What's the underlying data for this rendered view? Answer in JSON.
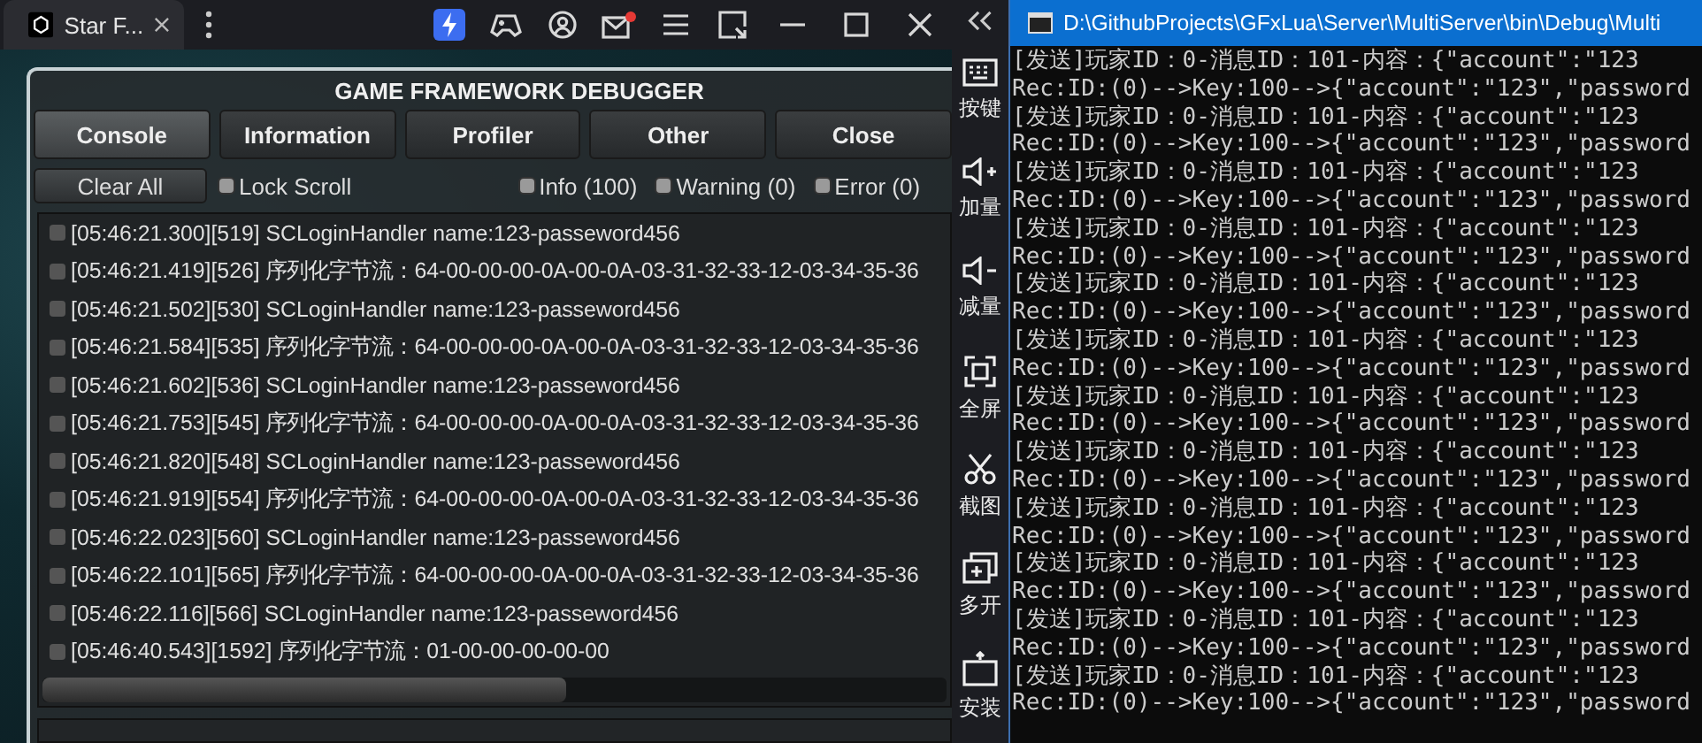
{
  "emulator": {
    "tab": {
      "title": "Star F..."
    },
    "debugger": {
      "title": "GAME FRAMEWORK DEBUGGER",
      "tabs": [
        {
          "label": "Console",
          "selected": true
        },
        {
          "label": "Information",
          "selected": false
        },
        {
          "label": "Profiler",
          "selected": false
        },
        {
          "label": "Other",
          "selected": false
        },
        {
          "label": "Close",
          "selected": false
        }
      ],
      "clear_button": "Clear All",
      "toggles": [
        {
          "label": "Lock Scroll",
          "checked": false
        },
        {
          "label": "Info (100)",
          "checked": false
        },
        {
          "label": "Warning (0)",
          "checked": false
        },
        {
          "label": "Error (0)",
          "checked": false
        }
      ],
      "log": [
        "[05:46:21.300][519] SCLoginHandler name:123-passeword456",
        "[05:46:21.419][526] 序列化字节流：64-00-00-00-0A-00-0A-03-31-32-33-12-03-34-35-36",
        "[05:46:21.502][530] SCLoginHandler name:123-passeword456",
        "[05:46:21.584][535] 序列化字节流：64-00-00-00-0A-00-0A-03-31-32-33-12-03-34-35-36",
        "[05:46:21.602][536] SCLoginHandler name:123-passeword456",
        "[05:46:21.753][545] 序列化字节流：64-00-00-00-0A-00-0A-03-31-32-33-12-03-34-35-36",
        "[05:46:21.820][548] SCLoginHandler name:123-passeword456",
        "[05:46:21.919][554] 序列化字节流：64-00-00-00-0A-00-0A-03-31-32-33-12-03-34-35-36",
        "[05:46:22.023][560] SCLoginHandler name:123-passeword456",
        "[05:46:22.101][565] 序列化字节流：64-00-00-00-0A-00-0A-03-31-32-33-12-03-34-35-36",
        "[05:46:22.116][566] SCLoginHandler name:123-passeword456",
        "[05:46:40.543][1592] 序列化字节流：01-00-00-00-00-00"
      ]
    }
  },
  "sidebar": {
    "items": [
      {
        "label": "按键"
      },
      {
        "label": "加量"
      },
      {
        "label": "减量"
      },
      {
        "label": "全屏"
      },
      {
        "label": "截图"
      },
      {
        "label": "多开"
      },
      {
        "label": "安装"
      }
    ]
  },
  "console": {
    "title": "D:\\GithubProjects\\GFxLua\\Server\\MultiServer\\bin\\Debug\\Multi",
    "lines": [
      "[发送]玩家ID：0-消息ID：101-内容：{\"account\":\"123",
      "Rec:ID:(0)-->Key:100-->{\"account\":\"123\",\"password",
      "[发送]玩家ID：0-消息ID：101-内容：{\"account\":\"123",
      "Rec:ID:(0)-->Key:100-->{\"account\":\"123\",\"password",
      "[发送]玩家ID：0-消息ID：101-内容：{\"account\":\"123",
      "Rec:ID:(0)-->Key:100-->{\"account\":\"123\",\"password",
      "[发送]玩家ID：0-消息ID：101-内容：{\"account\":\"123",
      "Rec:ID:(0)-->Key:100-->{\"account\":\"123\",\"password",
      "[发送]玩家ID：0-消息ID：101-内容：{\"account\":\"123",
      "Rec:ID:(0)-->Key:100-->{\"account\":\"123\",\"password",
      "[发送]玩家ID：0-消息ID：101-内容：{\"account\":\"123",
      "Rec:ID:(0)-->Key:100-->{\"account\":\"123\",\"password",
      "[发送]玩家ID：0-消息ID：101-内容：{\"account\":\"123",
      "Rec:ID:(0)-->Key:100-->{\"account\":\"123\",\"password",
      "[发送]玩家ID：0-消息ID：101-内容：{\"account\":\"123",
      "Rec:ID:(0)-->Key:100-->{\"account\":\"123\",\"password",
      "[发送]玩家ID：0-消息ID：101-内容：{\"account\":\"123",
      "Rec:ID:(0)-->Key:100-->{\"account\":\"123\",\"password",
      "[发送]玩家ID：0-消息ID：101-内容：{\"account\":\"123",
      "Rec:ID:(0)-->Key:100-->{\"account\":\"123\",\"password",
      "[发送]玩家ID：0-消息ID：101-内容：{\"account\":\"123",
      "Rec:ID:(0)-->Key:100-->{\"account\":\"123\",\"password",
      "[发送]玩家ID：0-消息ID：101-内容：{\"account\":\"123",
      "Rec:ID:(0)-->Key:100-->{\"account\":\"123\",\"password"
    ]
  }
}
